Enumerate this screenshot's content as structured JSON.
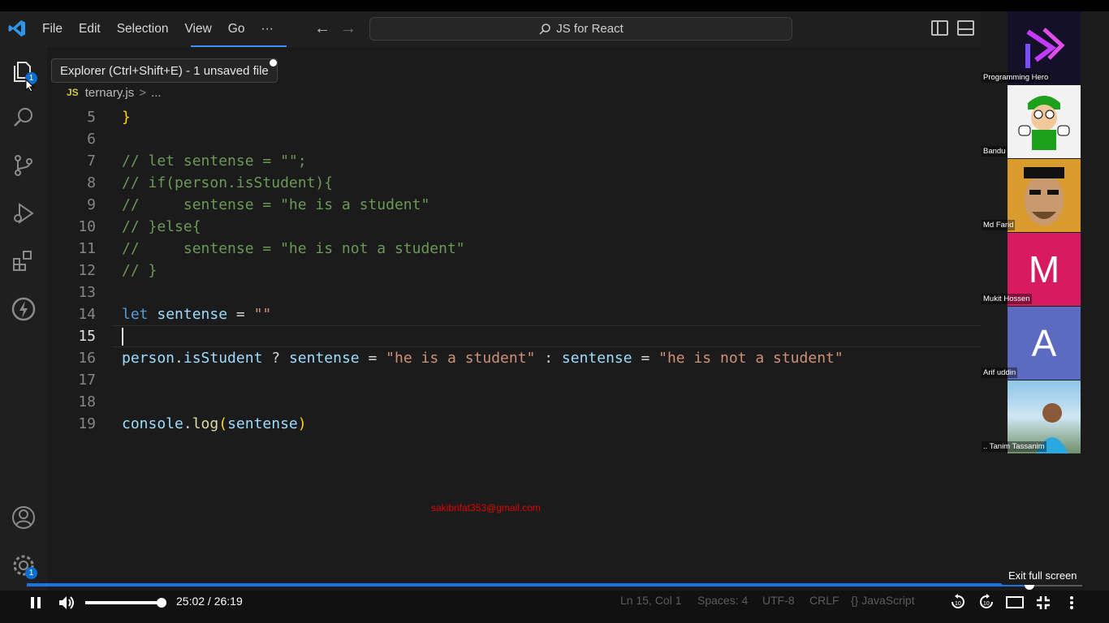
{
  "menu": [
    "File",
    "Edit",
    "Selection",
    "View",
    "Go",
    "···"
  ],
  "search": {
    "text": "JS for React"
  },
  "tooltip": "Explorer (Ctrl+Shift+E) - 1 unsaved file",
  "badges": {
    "explorer": "1",
    "settings": "1"
  },
  "breadcrumb": {
    "lang": "JS",
    "file": "ternary.js",
    "sep": ">",
    "more": "..."
  },
  "code": {
    "l5": {
      "num": "5",
      "text": "}"
    },
    "l6": {
      "num": "6"
    },
    "l7": {
      "num": "7",
      "text": "// let sentense = \"\";"
    },
    "l8": {
      "num": "8",
      "text": "// if(person.isStudent){"
    },
    "l9": {
      "num": "9",
      "text": "//     sentense = \"he is a student\""
    },
    "l10": {
      "num": "10",
      "text": "// }else{"
    },
    "l11": {
      "num": "11",
      "text": "//     sentense = \"he is not a student\""
    },
    "l12": {
      "num": "12",
      "text": "// }"
    },
    "l13": {
      "num": "13"
    },
    "l14": {
      "num": "14",
      "kw": "let",
      "var": "sentense",
      "op": " = ",
      "str": "\"\""
    },
    "l15": {
      "num": "15"
    },
    "l16": {
      "num": "16",
      "p1": "person",
      "dot": ".",
      "p2": "isStudent",
      "q": " ? ",
      "v1": "sentense",
      "eq1": " = ",
      "s1": "\"he is a student\"",
      "colon": " : ",
      "v2": "sentense",
      "eq2": " = ",
      "s2": "\"he is not a student\""
    },
    "l17": {
      "num": "17"
    },
    "l18": {
      "num": "18"
    },
    "l19": {
      "num": "19",
      "obj": "console",
      "dot": ".",
      "fn": "log",
      "open": "(",
      "arg": "sentense",
      "close": ")"
    }
  },
  "email": "sakibrifat353@gmail.com",
  "participants": [
    {
      "name": "Programming Hero"
    },
    {
      "name": "Bandu"
    },
    {
      "name": "Md Farid"
    },
    {
      "name": "Mukit Hossen",
      "initial": "M"
    },
    {
      "name": "Arif uddin",
      "initial": "A"
    },
    {
      "name": ".. Tanim Tassanim"
    }
  ],
  "statusbar": {
    "position": "Ln 15, Col 1",
    "spaces": "Spaces: 4",
    "encoding": "UTF-8",
    "eol": "CRLF",
    "language": "{} JavaScript"
  },
  "player": {
    "time": "25:02 / 26:19",
    "progress": 0.95,
    "volume": 1.0,
    "exit_tip": "Exit full screen"
  },
  "colors": {
    "accent": "#1a73e8",
    "comment": "#6a9955",
    "keyword": "#569cd6",
    "variable": "#9cdcfe",
    "string": "#ce9178",
    "function": "#dcdcaa"
  }
}
